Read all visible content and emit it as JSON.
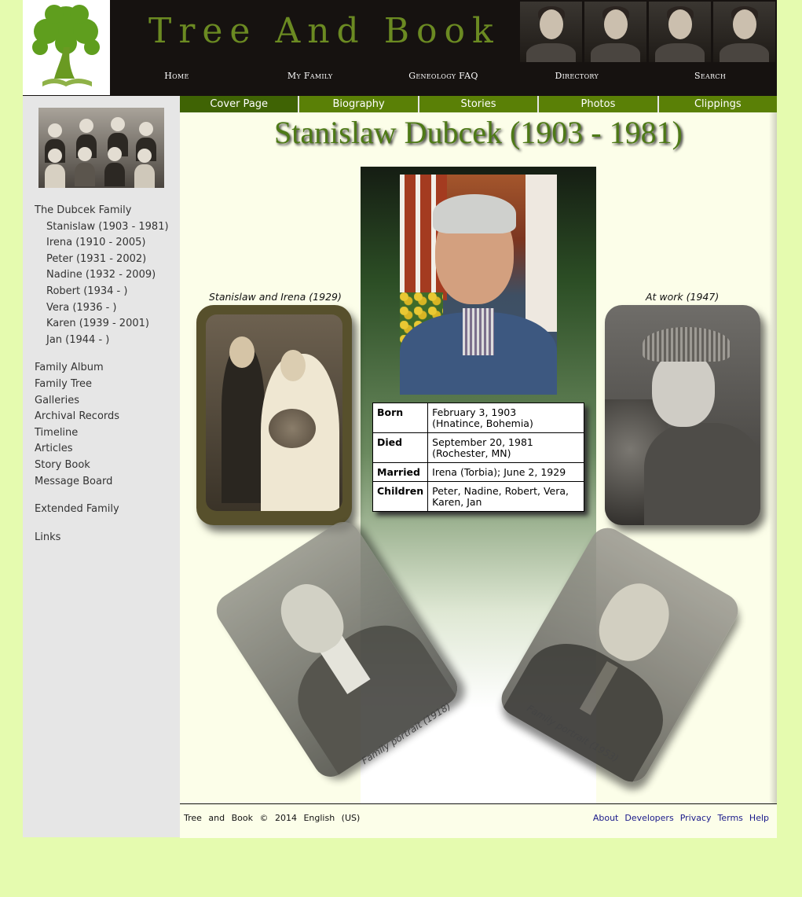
{
  "site": {
    "title": "Tree And Book"
  },
  "topnav": [
    "Home",
    "My Family",
    "Geneology FAQ",
    "Directory",
    "Search"
  ],
  "tabs": [
    "Cover Page",
    "Biography",
    "Stories",
    "Photos",
    "Clippings"
  ],
  "active_tab": "Cover Page",
  "sidebar": {
    "family_heading": "The Dubcek Family",
    "members": [
      "Stanislaw (1903 - 1981)",
      "Irena (1910 - 2005)",
      "Peter (1931 - 2002)",
      "Nadine (1932 - 2009)",
      "Robert (1934 - )",
      "Vera (1936 - )",
      "Karen (1939 - 2001)",
      "Jan (1944 - )"
    ],
    "links": [
      "Family Album",
      "Family Tree",
      "Galleries",
      "Archival Records",
      "Timeline",
      "Articles",
      "Story Book",
      "Message Board"
    ],
    "extended": "Extended Family",
    "links2": "Links"
  },
  "page_title": "Stanislaw Dubcek (1903 - 1981)",
  "info": {
    "born_label": "Born",
    "born_date": "February 3, 1903",
    "born_place": "(Hnatince, Bohemia)",
    "died_label": "Died",
    "died_date": "September 20, 1981",
    "died_place": "(Rochester, MN)",
    "married_label": "Married",
    "married_value": "Irena (Torbia); June 2, 1929",
    "children_label": "Children",
    "children_line1": "Peter, Nadine, Robert, Vera,",
    "children_line2": "Karen, Jan"
  },
  "captions": {
    "wedding": "Stanislaw and Irena (1929)",
    "work": "At work (1947)",
    "portrait_1918": "Family portrait (1918)",
    "portrait_1953": "Family portrait (1953)"
  },
  "footer": {
    "left": "Tree and Book © 2014 English (US)",
    "links": [
      "About",
      "Developers",
      "Privacy",
      "Terms",
      "Help"
    ]
  },
  "colors": {
    "page_bg": "#e5fbaf",
    "tab_green": "#5a8006",
    "title_green": "#4e7a17",
    "header_bg": "#161210"
  }
}
